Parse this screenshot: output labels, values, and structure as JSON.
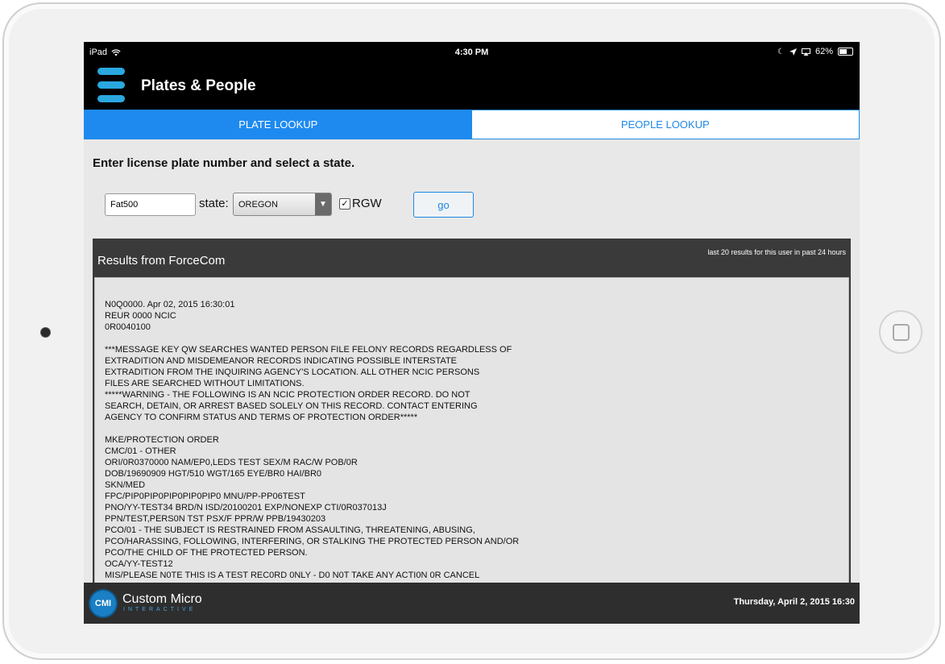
{
  "status_bar": {
    "device": "iPad",
    "time": "4:30 PM",
    "battery": "62%",
    "battery_level": 0.62
  },
  "app": {
    "title": "Plates & People"
  },
  "tabs": [
    {
      "label": "PLATE LOOKUP",
      "active": true
    },
    {
      "label": "PEOPLE LOOKUP",
      "active": false
    }
  ],
  "form": {
    "instruction": "Enter license plate number and select a state.",
    "plate_value": "Fat500",
    "state_label": "state:",
    "state_value": "OREGON",
    "rgw_checked": true,
    "rgw_label": "RGW",
    "go_label": "go"
  },
  "results": {
    "title": "Results from ForceCom",
    "note": "last 20 results for this user in past 24 hours",
    "lines": [
      "N0Q0000. Apr 02, 2015 16:30:01",
      "REUR 0000 NCIC",
      "0R0040100",
      "",
      "***MESSAGE KEY QW SEARCHES WANTED PERSON FILE FELONY RECORDS REGARDLESS OF",
      "EXTRADITION AND MISDEMEANOR RECORDS INDICATING POSSIBLE INTERSTATE",
      "EXTRADITION FROM THE INQUIRING AGENCY'S LOCATION. ALL OTHER NCIC PERSONS",
      "FILES ARE SEARCHED WITHOUT LIMITATIONS.",
      "*****WARNING - THE FOLLOWING IS AN NCIC PROTECTION ORDER RECORD. DO NOT",
      "SEARCH, DETAIN, OR ARREST BASED SOLELY ON THIS RECORD. CONTACT ENTERING",
      "AGENCY TO CONFIRM STATUS AND TERMS OF PROTECTION ORDER*****",
      "",
      "MKE/PROTECTION ORDER",
      "CMC/01 - OTHER",
      "ORI/0R0370000 NAM/EP0,LEDS TEST SEX/M RAC/W POB/0R",
      "DOB/19690909 HGT/510 WGT/165 EYE/BR0 HAI/BR0",
      "SKN/MED",
      "FPC/PIP0PIP0PIP0PIP0PIP0 MNU/PP-PP06TEST",
      "PNO/YY-TEST34 BRD/N ISD/20100201 EXP/NONEXP CTI/0R037013J",
      "PPN/TEST,PERS0N TST PSX/F PPR/W PPB/19430203",
      "PCO/01 - THE SUBJECT IS RESTRAINED FROM ASSAULTING, THREATENING, ABUSING,",
      "PCO/HARASSING, FOLLOWING, INTERFERING, OR STALKING THE PROTECTED PERSON AND/OR",
      "PCO/THE CHILD OF THE PROTECTED PERSON.",
      "OCA/YY-TEST12",
      "MIS/PLEASE N0TE THIS IS A TEST REC0RD 0NLY - D0 N0T TAKE ANY ACTI0N 0R CANCEL"
    ]
  },
  "footer": {
    "logo_abbr": "CMI",
    "logo_name": "Custom Micro",
    "logo_sub": "INTERACTIVE",
    "datetime": "Thursday, April 2, 2015 16:30"
  }
}
